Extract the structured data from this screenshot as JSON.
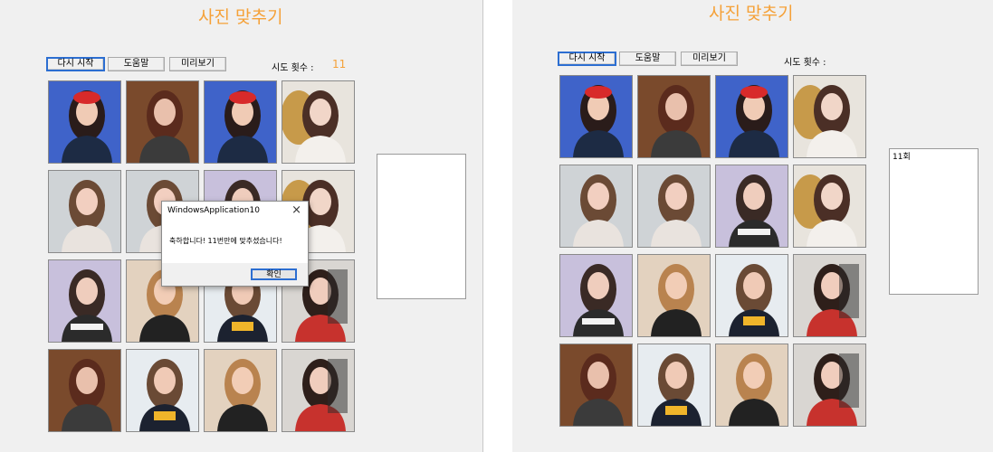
{
  "left": {
    "title": "사진 맞추기",
    "buttons": {
      "restart": "다시 시작",
      "help": "도움말",
      "preview": "미리보기"
    },
    "attempts_label": "시도 횟수 :",
    "attempts_value": "11",
    "list_items": [],
    "tiles": [
      "blue-singer",
      "brown-hair-woman",
      "blue-singer",
      "flowers-bnt",
      "long-hair-woman",
      "long-hair-woman",
      "holiday-sweater",
      "flowers-bnt",
      "holiday-sweater",
      "blonde-woman",
      "capture-tshirt",
      "sitting-woman",
      "brown-hair-woman",
      "capture-tshirt",
      "blonde-woman",
      "sitting-woman"
    ],
    "dialog": {
      "title": "WindowsApplication10",
      "message": "축하합니다! 11번만에 맞추셨습니다!",
      "ok": "확인",
      "close": "×"
    }
  },
  "right": {
    "title": "사진 맞추기",
    "buttons": {
      "restart": "다시 시작",
      "help": "도움말",
      "preview": "미리보기"
    },
    "attempts_label": "시도 횟수 :",
    "list_items": [
      "11회"
    ],
    "tiles": [
      "blue-singer",
      "brown-hair-woman",
      "blue-singer",
      "flowers-bnt",
      "long-hair-woman",
      "long-hair-woman",
      "holiday-sweater",
      "flowers-bnt",
      "holiday-sweater",
      "blonde-woman",
      "capture-tshirt",
      "sitting-woman",
      "brown-hair-woman",
      "capture-tshirt",
      "blonde-woman",
      "sitting-woman"
    ]
  },
  "colors": {
    "accent": "#f5a138",
    "focus": "#2c6ed1"
  }
}
